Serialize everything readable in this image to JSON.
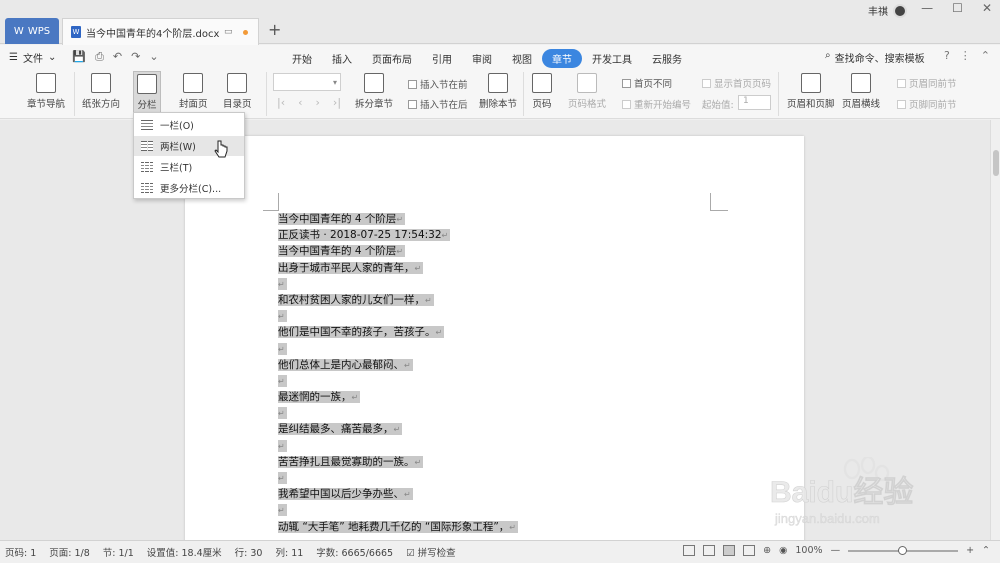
{
  "app": {
    "wps_tab": "WPS",
    "doc_tab": "当今中国青年的4个阶层.docx",
    "user": "丰祺"
  },
  "menubar": {
    "file": "文件",
    "menus": [
      "开始",
      "插入",
      "页面布局",
      "引用",
      "审阅",
      "视图",
      "章节",
      "开发工具",
      "云服务"
    ],
    "active_menu": "章节",
    "search": "查找命令、搜索模板"
  },
  "ribbon": {
    "chapter_nav": "章节导航",
    "paper_direction": "纸张方向",
    "columns": "分栏",
    "cover": "封面页",
    "toc": "目录页",
    "split_chapter": "拆分章节",
    "insert_before": "插入节在前",
    "insert_after": "插入节在后",
    "delete_section": "删除本节",
    "page_number": "页码",
    "page_number_format": "页码格式",
    "first_page_diff": "首页不同",
    "show_first_page_number": "显示首页页码",
    "restart_numbering": "重新开始编号",
    "start_value_label": "起始值:",
    "start_value": "1",
    "header_footer": "页眉和页脚",
    "header_line": "页眉横线",
    "header_same_prev": "页眉同前节",
    "footer_same_prev": "页脚同前节"
  },
  "dropdown": {
    "items": [
      "一栏(O)",
      "两栏(W)",
      "三栏(T)",
      "更多分栏(C)..."
    ],
    "hovered": "两栏(W)"
  },
  "document": {
    "lines": [
      "当今中国青年的 4 个阶层",
      "正反读书 · 2018-07-25 17:54:32",
      "当今中国青年的 4 个阶层",
      "出身于城市平民人家的青年，",
      "",
      "和农村贫困人家的儿女们一样，",
      "",
      "他们是中国不幸的孩子，苦孩子。",
      "",
      "他们总体上是内心最郁闷、",
      "",
      "最迷惘的一族，",
      "",
      "是纠结最多、痛苦最多，",
      "",
      "苦苦挣扎且最觉寡助的一族。",
      "",
      "我希望中国以后少争办些、",
      "",
      "动辄 “大手笔” 地耗费几千亿的 “国际形象工程”，"
    ],
    "paragraph_mark": "↵"
  },
  "status": {
    "page_no": "页码: 1",
    "pages": "页面: 1/8",
    "section": "节: 1/1",
    "setting": "设置值: 18.4厘米",
    "row": "行: 30",
    "col": "列: 11",
    "word_count": "字数: 6665/6665",
    "spell_check": "拼写检查",
    "zoom": "100%"
  },
  "watermark": {
    "text": "Baidu经验",
    "url": "jingyan.baidu.com"
  }
}
